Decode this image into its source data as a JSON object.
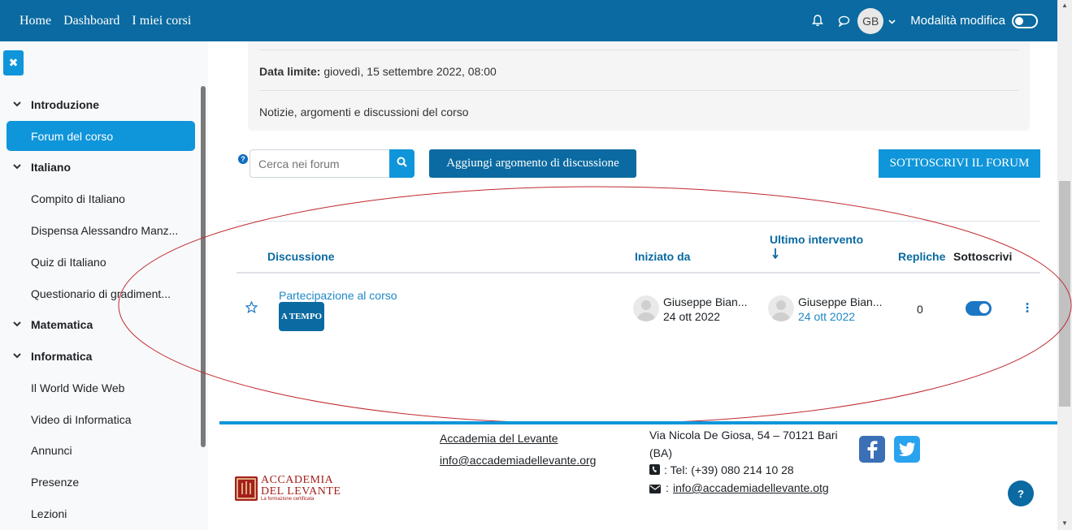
{
  "navbar": {
    "links": [
      "Home",
      "Dashboard",
      "I miei corsi"
    ],
    "avatar_initials": "GB",
    "edit_mode_label": "Modalità modifica",
    "icons": [
      "bell-icon",
      "chat-icon",
      "chevron-down-icon"
    ]
  },
  "drawer": {
    "items": [
      {
        "label": "Introduzione",
        "type": "section"
      },
      {
        "label": "Forum del corso",
        "type": "active"
      },
      {
        "label": "Italiano",
        "type": "section"
      },
      {
        "label": "Compito di Italiano",
        "type": "item"
      },
      {
        "label": "Dispensa Alessandro Manz...",
        "type": "item"
      },
      {
        "label": "Quiz di Italiano",
        "type": "item"
      },
      {
        "label": "Questionario di gradiment...",
        "type": "item"
      },
      {
        "label": "Matematica",
        "type": "section"
      },
      {
        "label": "Informatica",
        "type": "section"
      },
      {
        "label": "Il World Wide Web",
        "type": "item"
      },
      {
        "label": "Video di Informatica",
        "type": "item"
      },
      {
        "label": "Annunci",
        "type": "item"
      },
      {
        "label": "Presenze",
        "type": "item"
      },
      {
        "label": "Lezioni",
        "type": "item"
      }
    ]
  },
  "info": {
    "due_label": "Data limite:",
    "due_value": "giovedì, 15 settembre 2022, 08:00",
    "description": "Notizie, argomenti e discussioni del corso"
  },
  "actions": {
    "search_placeholder": "Cerca nei forum",
    "add_label": "Aggiungi argomento di discussione",
    "subscribe_label": "SOTTOSCRIVI IL FORUM"
  },
  "table": {
    "headers": {
      "discussion": "Discussione",
      "started_by": "Iniziato da",
      "last_post": "Ultimo intervento",
      "replies": "Repliche",
      "subscribe": "Sottoscrivi"
    },
    "rows": [
      {
        "title": "Partecipazione al corso",
        "badge": "A TEMPO",
        "starter_name": "Giuseppe Bian...",
        "starter_date": "24 ott 2022",
        "last_name": "Giuseppe Bian...",
        "last_date": "24 ott 2022",
        "replies": "0",
        "subscribed": true
      }
    ]
  },
  "footer": {
    "org_link": "Accademia del Levante",
    "email_link": "info@accademiadellevante.org",
    "address": "Via Nicola De Giosa, 54 – 70121 Bari",
    "address2": "(BA)",
    "tel": ": Tel: (+39) 080 214 10 28",
    "email2_prefix": ":",
    "email2": "info@accademiadellevante.otg",
    "logo_line1": "ACCADEMIA",
    "logo_line2": "DEL LEVANTE",
    "logo_tagline": "La formazione certificata"
  },
  "colors": {
    "navbar": "#0a6aa1",
    "accent": "#0f95d9",
    "link": "#0a6aa1",
    "ellipse": "#c0282d"
  }
}
